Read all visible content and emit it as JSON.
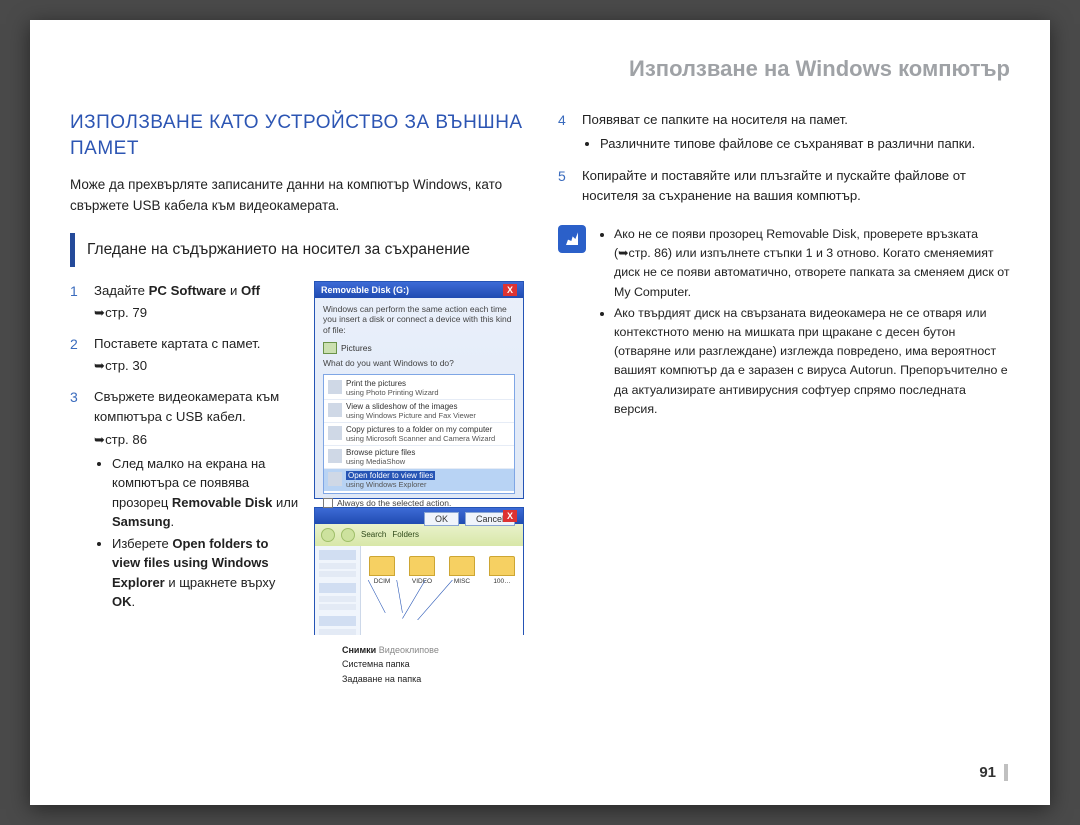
{
  "chapter": "Използване на Windows компютър",
  "h1": "ИЗПОЛЗВАНЕ КАТО УСТРОЙСТВО ЗА ВЪНШНА ПАМЕТ",
  "lead": "Може да прехвърляте записаните данни на компютър Windows, като свържете USB кабела към видеокамерата.",
  "subsection": "Гледане на съдържанието на носител за съхранение",
  "steps": {
    "s1": {
      "num": "1",
      "text_pre": "Задайте ",
      "b1": "PC Software",
      "mid": " и ",
      "b2": "Off",
      "ref": "стр. 79"
    },
    "s2": {
      "num": "2",
      "text": "Поставете картата с памет.",
      "ref": "стр. 30"
    },
    "s3": {
      "num": "3",
      "text": "Свържете видеокамерата към компютъра с USB кабел.",
      "ref": "стр. 86",
      "bullets": [
        {
          "pre": "След малко на екрана на компютъра се появява прозорец ",
          "b1": "Removable Disk",
          "mid": " или ",
          "b2": "Samsung",
          "end": "."
        },
        {
          "pre": "Изберете ",
          "b1": "Open folders to view files using Windows Explorer",
          "mid": " и щракнете върху ",
          "b2": "OK",
          "end": "."
        }
      ]
    },
    "s4": {
      "num": "4",
      "text": "Появяват се папките на носителя на памет.",
      "bullets": [
        "Различните типове файлове се съхраняват в различни папки."
      ]
    },
    "s5": {
      "num": "5",
      "text": "Копирайте и поставяйте или плъзгайте и пускайте файлове от носителя за съхранение на вашия компютър."
    }
  },
  "dialog1": {
    "title": "Removable Disk (G:)",
    "line1": "Windows can perform the same action each time you insert a disk or connect a device with this kind of file:",
    "pictures": "Pictures",
    "q": "What do you want Windows to do?",
    "options": [
      {
        "l1": "Print the pictures",
        "l2": "using Photo Printing Wizard"
      },
      {
        "l1": "View a slideshow of the images",
        "l2": "using Windows Picture and Fax Viewer"
      },
      {
        "l1": "Copy pictures to a folder on my computer",
        "l2": "using Microsoft Scanner and Camera Wizard"
      },
      {
        "l1": "Browse picture files",
        "l2": "using MediaShow"
      },
      {
        "l1": "Open folder to view files",
        "l2": "using Windows Explorer"
      }
    ],
    "chk": "Always do the selected action.",
    "ok": "OK",
    "cancel": "Cancel"
  },
  "explorer": {
    "folders": [
      "DCIM",
      "VIDEO",
      "MISC",
      "100…"
    ]
  },
  "captions": {
    "c1a": "Снимки",
    "c1b": "Видеоклипове",
    "c2": "Системна папка",
    "c3": "Задаване на папка"
  },
  "info": [
    "Ако не се появи прозорец Removable Disk, проверете връзката (➥стр. 86) или изпълнете стъпки 1 и 3 отново. Когато сменяемият диск не се появи автоматично, отворете папката за сменяем диск от My Computer.",
    "Ако твърдият диск на свързаната видеокамера не се отваря или контекстното меню на мишката при щракане с десен бутон (отваряне или разглеждане) изглежда повредено, има вероятност вашият компютър да е заразен с вируса Autorun. Препоръчително е да актуализирате антивирусния софтуер спрямо последната версия."
  ],
  "pagenum": "91"
}
